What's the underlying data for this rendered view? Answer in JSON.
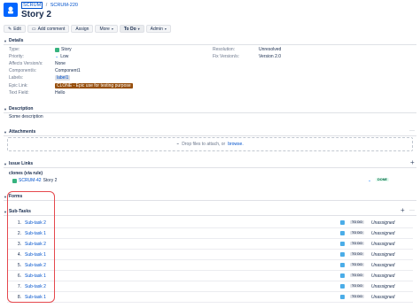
{
  "breadcrumb": {
    "project": "SCRUM",
    "issue_key": "SCRUM-220"
  },
  "issue": {
    "title": "Story 2"
  },
  "toolbar": {
    "edit": "Edit",
    "comment": "Add comment",
    "assign": "Assign",
    "more": "More",
    "status": "To Do",
    "admin": "Admin"
  },
  "details": {
    "heading": "Details",
    "type_label": "Type:",
    "type_value": "Story",
    "priority_label": "Priority:",
    "priority_value": "Low",
    "affects_label": "Affects Version/s:",
    "affects_value": "None",
    "components_label": "Component/s:",
    "components_value": "Component1",
    "labels_label": "Labels:",
    "labels_value": "label1",
    "epic_label": "Epic Link:",
    "epic_value": "CLONE - Epic use for testing purpose",
    "textfield_label": "Text Field:",
    "textfield_value": "Hello",
    "resolution_label": "Resolution:",
    "resolution_value": "Unresolved",
    "fixversion_label": "Fix Version/s:",
    "fixversion_value": "Version 2.0"
  },
  "description": {
    "heading": "Description",
    "text": "Some description"
  },
  "attachments": {
    "heading": "Attachments",
    "drop_text": "Drop files to attach, or",
    "browse": "browse."
  },
  "issue_links": {
    "heading": "Issue Links",
    "relation": "clones (via rule)",
    "link_key": "SCRUM-42",
    "link_title": "Story 2",
    "link_status": "DONE"
  },
  "forms": {
    "heading": "Forms"
  },
  "subtasks": {
    "heading": "Sub-Tasks",
    "rows": [
      {
        "num": "1.",
        "name": "Sub-task 2",
        "status": "TO DO",
        "assignee": "Unassigned"
      },
      {
        "num": "2.",
        "name": "Sub-task 1",
        "status": "TO DO",
        "assignee": "Unassigned"
      },
      {
        "num": "3.",
        "name": "Sub-task 2",
        "status": "TO DO",
        "assignee": "Unassigned"
      },
      {
        "num": "4.",
        "name": "Sub-task 1",
        "status": "TO DO",
        "assignee": "Unassigned"
      },
      {
        "num": "5.",
        "name": "Sub-task 2",
        "status": "TO DO",
        "assignee": "Unassigned"
      },
      {
        "num": "6.",
        "name": "Sub-task 1",
        "status": "TO DO",
        "assignee": "Unassigned"
      },
      {
        "num": "7.",
        "name": "Sub-task 2",
        "status": "TO DO",
        "assignee": "Unassigned"
      },
      {
        "num": "8.",
        "name": "Sub-task 1",
        "status": "TO DO",
        "assignee": "Unassigned"
      }
    ]
  },
  "colors": {
    "accent": "#0052cc",
    "highlight": "#e5484d",
    "story": "#36b37e",
    "epic": "#974f0c"
  }
}
